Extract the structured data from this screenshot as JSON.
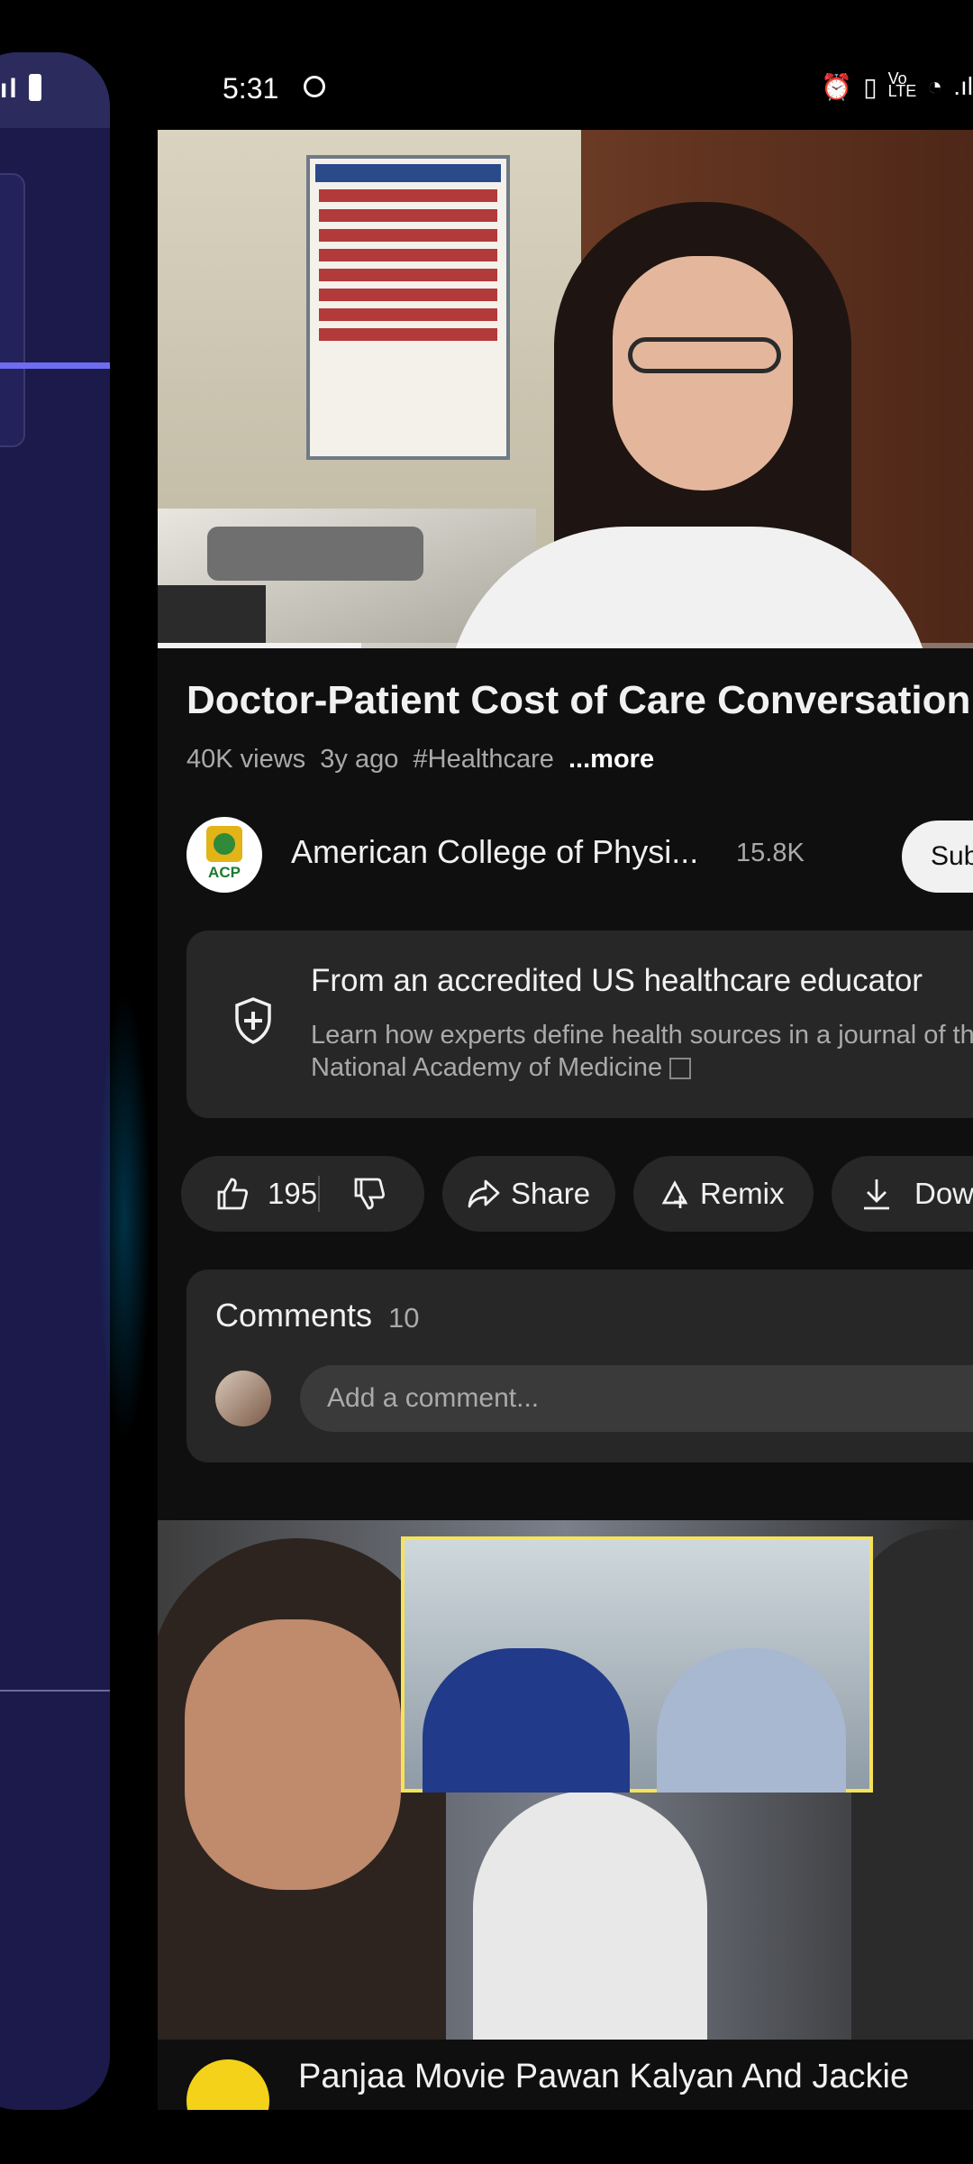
{
  "status_bar": {
    "time": "5:31",
    "left_app_signal": "ıl"
  },
  "video": {
    "title": "Doctor-Patient Cost of Care Conversation",
    "views": "40K views",
    "age": "3y ago",
    "hashtag": "#Healthcare",
    "more_label": "...more",
    "progress_fraction": 0.25
  },
  "channel": {
    "avatar_text": "ACP",
    "name": "American College of Physi...",
    "subscribers": "15.8K",
    "subscribe_label": "Subsc"
  },
  "info_panel": {
    "heading": "From an accredited US healthcare educator",
    "body": "Learn how experts define health sources in a journal of the National Academy of Medicine"
  },
  "actions": {
    "likes": "195",
    "share_label": "Share",
    "remix_label": "Remix",
    "download_label": "Dow"
  },
  "comments": {
    "title": "Comments",
    "count": "10",
    "placeholder": "Add a comment..."
  },
  "next_video": {
    "title": "Panjaa Movie Pawan Kalyan And Jackie"
  },
  "colors": {
    "app_bg": "#0f0f0f",
    "surface": "#272727",
    "left_panel": "#1b1a4a",
    "accent_line": "#6e6cf0"
  }
}
